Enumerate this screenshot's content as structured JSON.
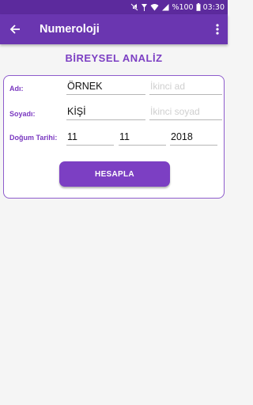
{
  "status_bar": {
    "battery_text": "%100",
    "time": "03:30"
  },
  "app_bar": {
    "title": "Numeroloji"
  },
  "section": {
    "title": "BİREYSEL ANALİZ"
  },
  "form": {
    "name_label": "Adı:",
    "name_value": "ÖRNEK",
    "second_name_placeholder": "İkinci ad",
    "surname_label": "Soyadı:",
    "surname_value": "KİŞİ",
    "second_surname_placeholder": "İkinci soyad",
    "birth_label": "Doğum Tarihi:",
    "day": "11",
    "month": "11",
    "year": "2018",
    "submit_label": "HESAPLA"
  },
  "colors": {
    "primary": "#6a36b0",
    "status": "#5c2a9d",
    "accent": "#7c3fc3"
  },
  "icons": [
    "silent-icon",
    "signal-icon",
    "wifi-icon",
    "cellular-icon",
    "battery-icon",
    "back-arrow-icon",
    "more-vert-icon"
  ]
}
